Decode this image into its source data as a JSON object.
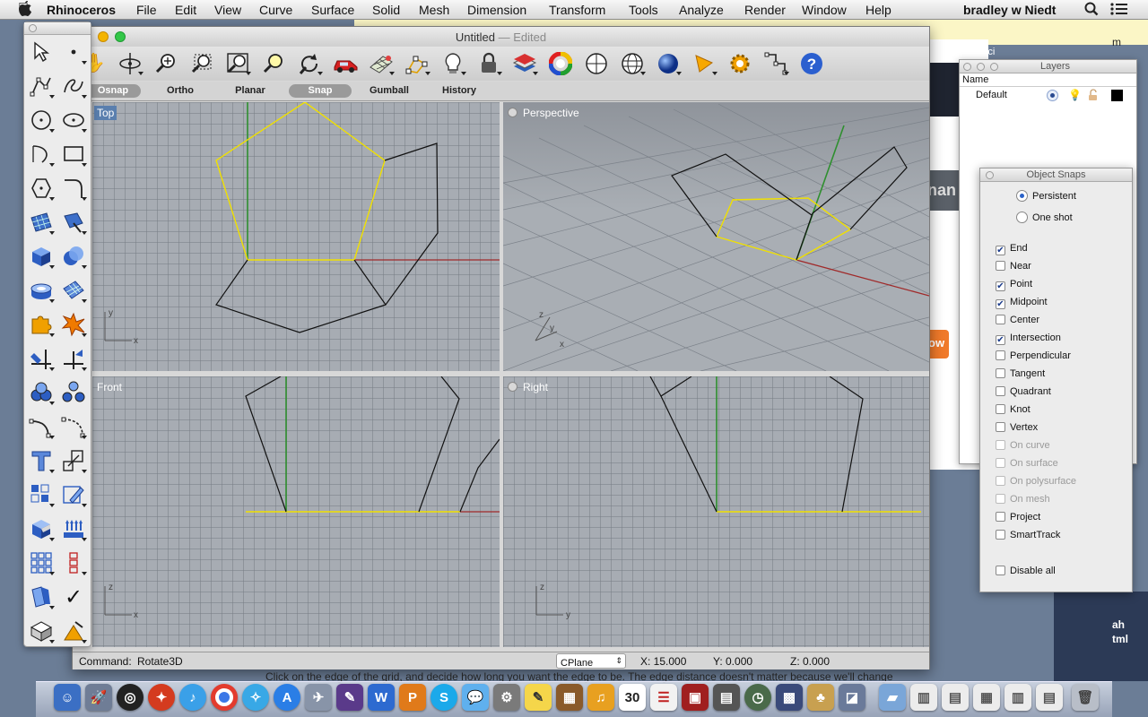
{
  "menubar": {
    "apple_icon": "apple-icon",
    "app_name": "Rhinoceros",
    "items": [
      "File",
      "Edit",
      "View",
      "Curve",
      "Surface",
      "Solid",
      "Mesh",
      "Dimension",
      "Transform",
      "Tools",
      "Analyze",
      "Render",
      "Window",
      "Help"
    ],
    "user": "bradley w Niedt"
  },
  "window": {
    "title": "Untitled",
    "edited": "— Edited"
  },
  "toolbar_icons": [
    "pan-icon",
    "rotate-view-icon",
    "zoom-icon",
    "zoom-window-icon",
    "zoom-extents-icon",
    "zoom-selected-icon",
    "undo-view-icon",
    "car-icon",
    "grid-icon",
    "points-icon",
    "light-icon",
    "lock-icon",
    "layers-icon",
    "color-wheel-icon",
    "sphere-wire-icon",
    "globe-wire-icon",
    "blue-sphere-icon",
    "cone-icon",
    "gear-icon",
    "analyze-icon",
    "help-icon"
  ],
  "modes": [
    {
      "label": "Osnap",
      "on": true
    },
    {
      "label": "Ortho",
      "on": false
    },
    {
      "label": "Planar",
      "on": false
    },
    {
      "label": "Snap",
      "on": true
    },
    {
      "label": "Gumball",
      "on": false
    },
    {
      "label": "History",
      "on": false
    }
  ],
  "viewports": {
    "top": "Top",
    "perspective": "Perspective",
    "front": "Front",
    "right": "Right"
  },
  "status": {
    "command_label": "Command:",
    "command_value": "Rotate3D",
    "cplane": "CPlane",
    "x": "X: 15.000",
    "y": "Y: 0.000",
    "z": "Z: 0.000"
  },
  "hint": "Click on the edge of the grid, and decide how long you want the edge to be. The edge distance doesn't matter because we'll change",
  "layers": {
    "title": "Layers",
    "col_name": "Name",
    "rows": [
      {
        "name": "Default"
      }
    ]
  },
  "osnap": {
    "title": "Object Snaps",
    "persistent": "Persistent",
    "one_shot": "One shot",
    "items": [
      {
        "label": "End",
        "checked": true,
        "enabled": true
      },
      {
        "label": "Near",
        "checked": false,
        "enabled": true
      },
      {
        "label": "Point",
        "checked": true,
        "enabled": true
      },
      {
        "label": "Midpoint",
        "checked": true,
        "enabled": true
      },
      {
        "label": "Center",
        "checked": false,
        "enabled": true
      },
      {
        "label": "Intersection",
        "checked": true,
        "enabled": true
      },
      {
        "label": "Perpendicular",
        "checked": false,
        "enabled": true
      },
      {
        "label": "Tangent",
        "checked": false,
        "enabled": true
      },
      {
        "label": "Quadrant",
        "checked": false,
        "enabled": true
      },
      {
        "label": "Knot",
        "checked": false,
        "enabled": true
      },
      {
        "label": "Vertex",
        "checked": false,
        "enabled": true
      },
      {
        "label": "On curve",
        "checked": false,
        "enabled": false
      },
      {
        "label": "On surface",
        "checked": false,
        "enabled": false
      },
      {
        "label": "On polysurface",
        "checked": false,
        "enabled": false
      },
      {
        "label": "On mesh",
        "checked": false,
        "enabled": false
      },
      {
        "label": "Project",
        "checked": false,
        "enabled": true
      },
      {
        "label": "SmartTrack",
        "checked": false,
        "enabled": true
      }
    ],
    "disable_all": "Disable all"
  },
  "background": {
    "browser_tab": "bicycles – all ci",
    "frag_m": "m",
    "frag_an": "nan",
    "frag_ow": "ow",
    "frag_ah": "ah",
    "frag_tml": "tml"
  },
  "dock": {
    "calendar_day": "30"
  }
}
